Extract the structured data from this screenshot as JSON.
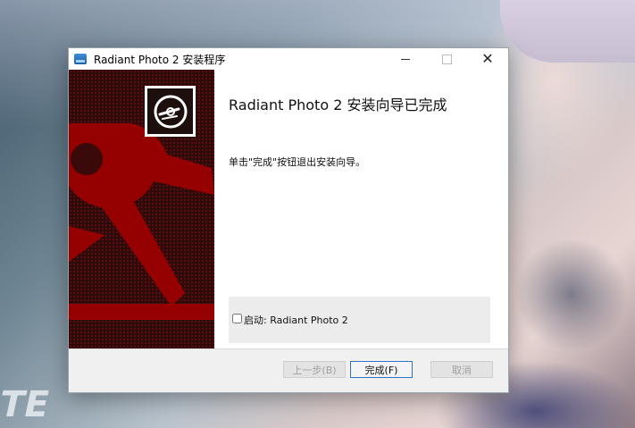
{
  "window": {
    "title": "Radiant Photo 2 安装程序",
    "controls": {
      "minimize": "—",
      "maximize": "☐",
      "close": "✕"
    }
  },
  "wallpaper": {
    "text": "TE"
  },
  "wizard": {
    "heading": "Radiant Photo 2 安装向导已完成",
    "body": "单击\"完成\"按钮退出安装向导。",
    "launch_checkbox": {
      "label": "启动: Radiant Photo 2",
      "checked": false
    }
  },
  "buttons": {
    "back": "上一步(B)",
    "finish": "完成(F)",
    "cancel": "取消"
  },
  "colors": {
    "banner_dark": "#300a0a",
    "banner_red": "#9b0000",
    "focus_blue": "#2f73c4"
  }
}
